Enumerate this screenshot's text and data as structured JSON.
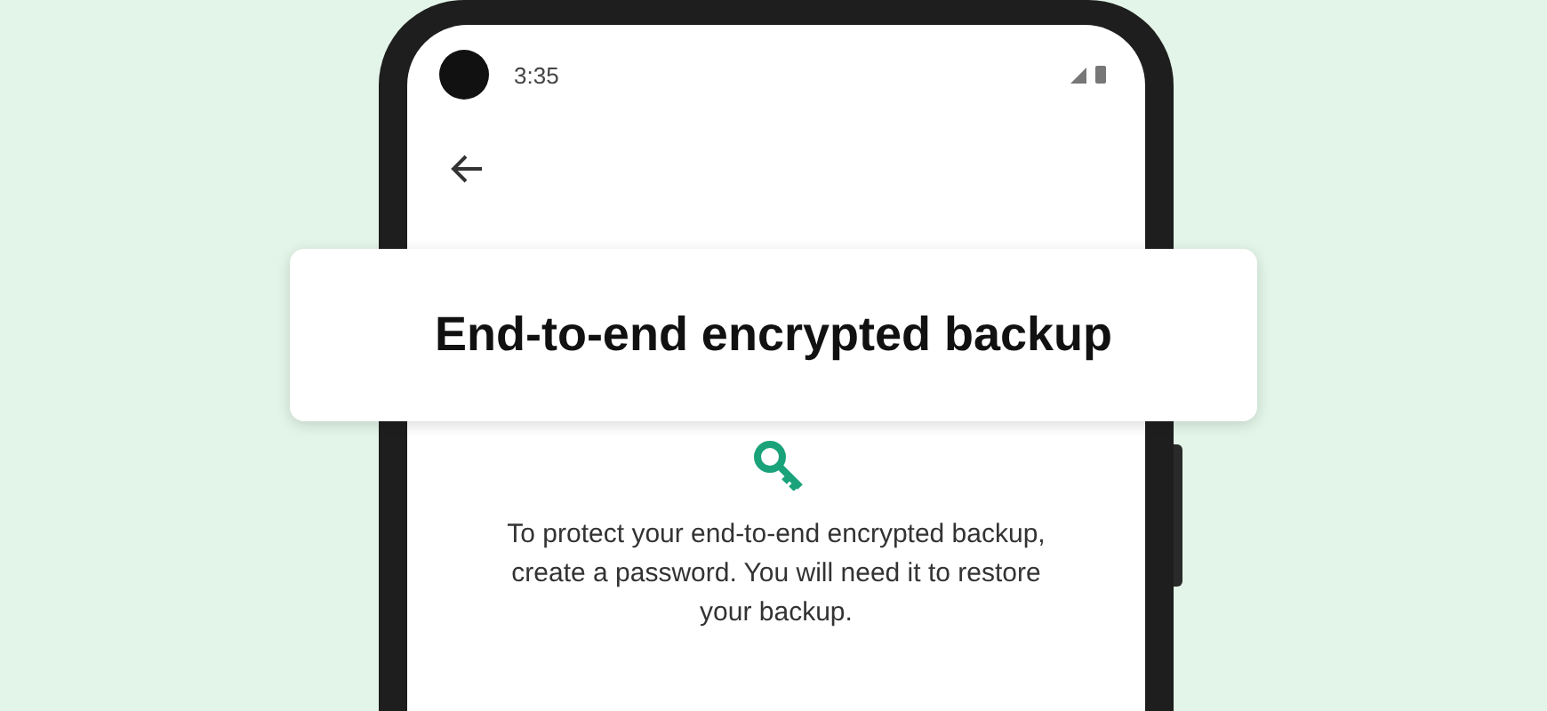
{
  "status_bar": {
    "time": "3:35"
  },
  "banner": {
    "title": "End-to-end encrypted backup"
  },
  "body": {
    "text": "To protect your end-to-end encrypted backup, create a password. You will need it to restore your backup."
  }
}
